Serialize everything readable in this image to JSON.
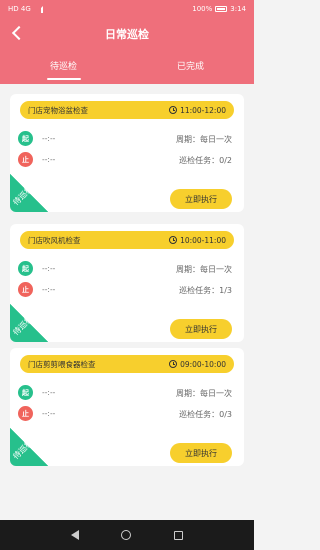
{
  "statusbar": {
    "left": "HD 4G",
    "battery": "100%",
    "time": "3:14"
  },
  "header": {
    "title": "日常巡检"
  },
  "tabs": [
    {
      "label": "待巡检",
      "active": true
    },
    {
      "label": "已完成",
      "active": false
    }
  ],
  "cards": [
    {
      "name": "门店宠物浴盆检查",
      "time": "11:00-12:00",
      "start_badge": "起",
      "stop_badge": "止",
      "start_value": "--:--",
      "stop_value": "--:--",
      "period": "周期：每日一次",
      "tasks": "巡检任务：0/2",
      "button": "立即执行",
      "status": "待巡检"
    },
    {
      "name": "门店吹风机检查",
      "time": "10:00-11:00",
      "start_badge": "起",
      "stop_badge": "止",
      "start_value": "--:--",
      "stop_value": "--:--",
      "period": "周期：每日一次",
      "tasks": "巡检任务：1/3",
      "button": "立即执行",
      "status": "待巡检"
    },
    {
      "name": "门店剪剪喂食器检查",
      "time": "09:00-10:00",
      "start_badge": "起",
      "stop_badge": "止",
      "start_value": "--:--",
      "stop_value": "--:--",
      "period": "周期：每日一次",
      "tasks": "巡检任务：0/3",
      "button": "立即执行",
      "status": "待巡检"
    }
  ],
  "colors": {
    "header": "#ef6f7b",
    "accent": "#f7cf2d",
    "green": "#27c08c",
    "red": "#f0645c"
  }
}
